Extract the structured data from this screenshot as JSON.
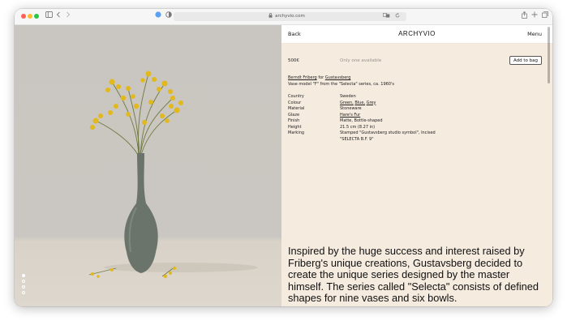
{
  "browser": {
    "url": "archyvio.com",
    "icons": [
      "sidebar-icon",
      "back-icon",
      "forward-icon",
      "extension-icon",
      "shield-icon",
      "lock-icon",
      "translate-icon",
      "reload-icon",
      "share-icon",
      "new-tab-icon",
      "tabs-icon"
    ]
  },
  "header": {
    "back_label": "Back",
    "brand": "ARCHYVIO",
    "menu_label": "Menu"
  },
  "product": {
    "price": "500€",
    "availability": "Only one available",
    "add_to_bag_label": "Add to bag",
    "designer": "Berndt Friberg",
    "for_word": "for",
    "manufacturer": "Gustavsberg",
    "model_line": "Vase model \"F\" from the \"Selecta\" series, ca. 1960's"
  },
  "specs": {
    "country_label": "Country",
    "country_value": "Sweden",
    "colour_label": "Colour",
    "colour_green": "Green,",
    "colour_blue": "Blue,",
    "colour_grey": "Grey",
    "material_label": "Material",
    "material_value": "Stoneware",
    "glaze_label": "Glaze",
    "glaze_value": "Hare's Fur",
    "finish_label": "Finish",
    "finish_value": "Matte, Bottle-shaped",
    "height_label": "Height",
    "height_value": "21.5 cm (8.27 in)",
    "marking_label": "Marking",
    "marking_value": "Stamped \"Gustavsberg studio symbol\", Incised \"SELECTA B.F. 9\""
  },
  "story": "Inspired by the huge success and interest raised by Friberg's unique creations, Gustavsberg decided to create the unique series designed by the master himself. The series called \"Selecta\" consists of defined shapes for nine vases and six bowls.",
  "gallery": {
    "slides": 4,
    "active_index": 0
  }
}
